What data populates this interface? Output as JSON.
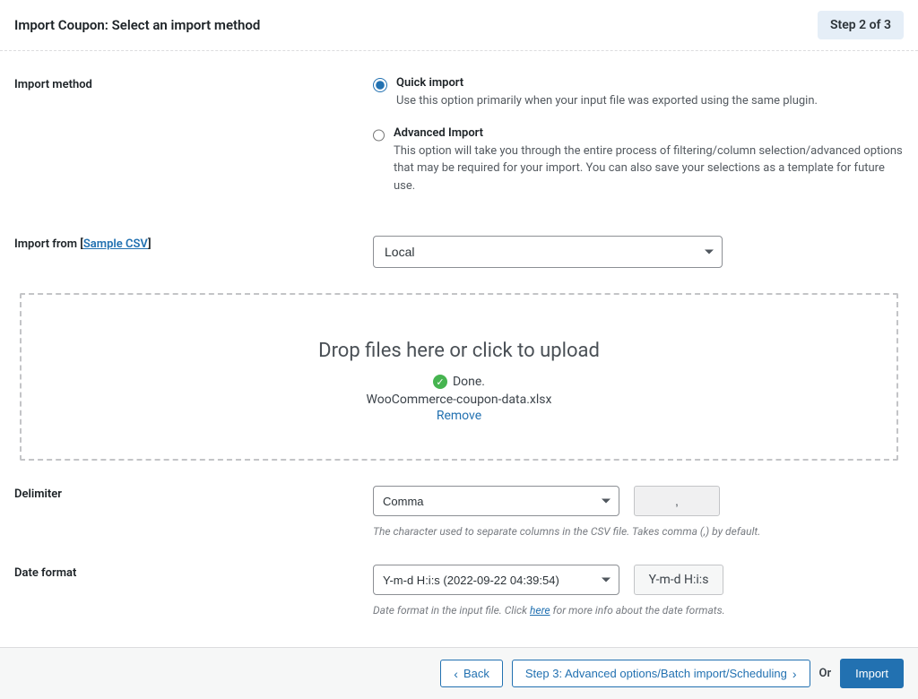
{
  "header": {
    "title": "Import Coupon: Select an import method",
    "step_badge": "Step 2 of 3"
  },
  "import_method": {
    "label": "Import method",
    "quick": {
      "title": "Quick import",
      "desc": "Use this option primarily when your input file was exported using the same plugin."
    },
    "advanced": {
      "title": "Advanced Import",
      "desc": "This option will take you through the entire process of filtering/column selection/advanced options that may be required for your import. You can also save your selections as a template for future use."
    }
  },
  "import_from": {
    "label_prefix": "Import from ",
    "sample_link": "Sample CSV",
    "selected": "Local"
  },
  "dropzone": {
    "title": "Drop files here or click to upload",
    "done": "Done.",
    "filename": "WooCommerce-coupon-data.xlsx",
    "remove": "Remove"
  },
  "delimiter": {
    "label": "Delimiter",
    "selected": "Comma",
    "value": ",",
    "helper": "The character used to separate columns in the CSV file. Takes comma (,) by default."
  },
  "date_format": {
    "label": "Date format",
    "selected": "Y-m-d H:i:s (2022-09-22 04:39:54)",
    "display": "Y-m-d H:i:s",
    "helper_pre": "Date format in the input file. Click ",
    "helper_link": "here",
    "helper_post": " for more info about the date formats."
  },
  "footer": {
    "back": "Back",
    "next": "Step 3: Advanced options/Batch import/Scheduling",
    "or": "Or",
    "import": "Import"
  }
}
